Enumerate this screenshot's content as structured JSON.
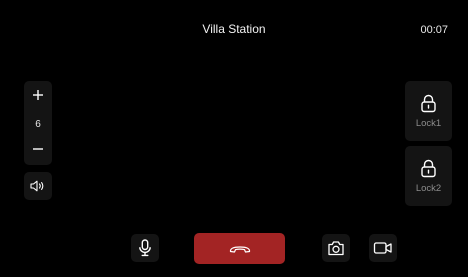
{
  "header": {
    "title": "Villa Station",
    "timer": "00:07"
  },
  "volume": {
    "increase_icon": "plus-icon",
    "value": "6",
    "decrease_icon": "minus-icon"
  },
  "speaker": {
    "icon": "speaker-icon"
  },
  "locks": [
    {
      "label": "Lock1",
      "icon": "lock-icon"
    },
    {
      "label": "Lock2",
      "icon": "lock-icon"
    }
  ],
  "controls": {
    "mic_icon": "microphone-icon",
    "hangup_icon": "hang-up-icon",
    "snapshot_icon": "camera-icon",
    "record_icon": "video-record-icon"
  },
  "colors": {
    "background": "#000000",
    "panel": "#141414",
    "hangup": "#a32424",
    "lock_label": "#8c8c8c",
    "text": "#ffffff"
  }
}
